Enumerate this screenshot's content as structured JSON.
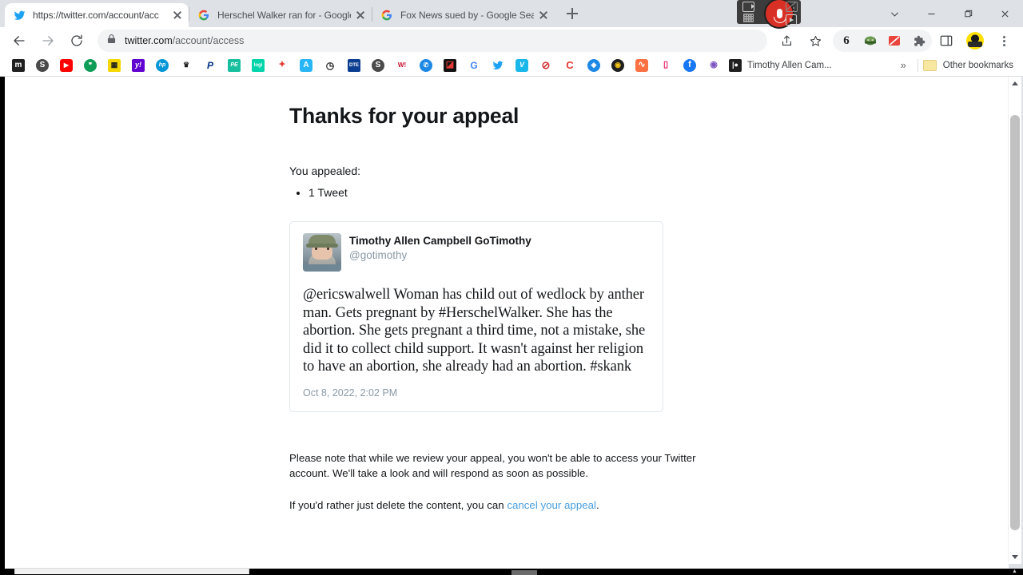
{
  "window": {
    "controls": [
      {
        "name": "tab-search",
        "glyph": "⌄"
      },
      {
        "name": "minimize",
        "glyph": "—"
      },
      {
        "name": "maximize",
        "glyph": "❐"
      },
      {
        "name": "close",
        "glyph": "✕"
      }
    ]
  },
  "tabs": [
    {
      "title": "https://twitter.com/account/acc",
      "favicon": "twitter-bird",
      "active": true
    },
    {
      "title": "Herschel Walker ran for - Google",
      "favicon": "google-g",
      "active": false
    },
    {
      "title": "Fox News sued by - Google Searc",
      "favicon": "google-g",
      "active": false
    }
  ],
  "newtab_label": "+",
  "recorder": {
    "mic_state": "recording",
    "icons": [
      "screen-capture-icon",
      "keypad-icon",
      "mic-record-button",
      "camera-off-icon",
      "play-icon"
    ]
  },
  "toolbar": {
    "back": "←",
    "forward": "→",
    "reload": "⟳",
    "url_domain": "twitter.com",
    "url_path": "/account/access",
    "share_icon": "share-icon",
    "bookmark_icon": "star-icon",
    "extensions": [
      {
        "name": "grammarly-extension",
        "label": "6",
        "bg": "#ffffff",
        "fg": "#1f1f1f"
      },
      {
        "name": "green-helmet-extension",
        "label": "",
        "bg": "#ffffff",
        "fg": "#2e7d32"
      },
      {
        "name": "red-block-extension",
        "label": "",
        "bg": "#ffffff",
        "fg": "#e53935"
      },
      {
        "name": "puzzle-extensions-icon",
        "label": "",
        "bg": "#ffffff",
        "fg": "#5f6368"
      }
    ],
    "side_panel_icon": "side-panel-icon",
    "profile_icon": "profile-avatar",
    "menu_icon": "three-dot-menu-icon"
  },
  "bookmarks": {
    "items": [
      {
        "name": "bookmark-m",
        "label": "m",
        "bg": "#1f1f1f",
        "fg": "#ffffff"
      },
      {
        "name": "bookmark-globe-1",
        "label": "S",
        "bg": "#4a4a4a",
        "fg": "#ffffff"
      },
      {
        "name": "bookmark-youtube",
        "label": "▶",
        "bg": "#ff0000",
        "fg": "#ffffff"
      },
      {
        "name": "bookmark-hangouts",
        "label": "❞",
        "bg": "#0f9d58",
        "fg": "#ffffff"
      },
      {
        "name": "bookmark-qr",
        "label": "▦",
        "bg": "#f5d800",
        "fg": "#1f1f1f"
      },
      {
        "name": "bookmark-yahoo",
        "label": "y!",
        "bg": "#6001d2",
        "fg": "#ffffff"
      },
      {
        "name": "bookmark-hp",
        "label": "hp",
        "bg": "#0096d6",
        "fg": "#ffffff"
      },
      {
        "name": "bookmark-crest",
        "label": "W",
        "bg": "#ffffff",
        "fg": "#1f1f1f"
      },
      {
        "name": "bookmark-paypal",
        "label": "P",
        "bg": "#ffffff",
        "fg": "#003087"
      },
      {
        "name": "bookmark-pe",
        "label": "PE",
        "bg": "#1abc9c",
        "fg": "#ffffff"
      },
      {
        "name": "bookmark-logi",
        "label": "logi",
        "bg": "#00d4aa",
        "fg": "#ffffff"
      },
      {
        "name": "bookmark-red-swirl",
        "label": "✦",
        "bg": "#ffffff",
        "fg": "#e03c31"
      },
      {
        "name": "bookmark-a",
        "label": "A",
        "bg": "#29b6f6",
        "fg": "#ffffff"
      },
      {
        "name": "bookmark-speedtest",
        "label": "◷",
        "bg": "#ffffff",
        "fg": "#1f1f1f"
      },
      {
        "name": "bookmark-dte",
        "label": "DTE",
        "bg": "#0b3d91",
        "fg": "#ffffff"
      },
      {
        "name": "bookmark-globe-2",
        "label": "S",
        "bg": "#4a4a4a",
        "fg": "#ffffff"
      },
      {
        "name": "bookmark-w",
        "label": "W!",
        "bg": "#ffffff",
        "fg": "#c8102e"
      },
      {
        "name": "bookmark-chat",
        "label": "✆",
        "bg": "#ffffff",
        "fg": "#1e88e5"
      },
      {
        "name": "bookmark-black-red",
        "label": "◪",
        "bg": "#111111",
        "fg": "#e53935"
      },
      {
        "name": "bookmark-google",
        "label": "G",
        "bg": "#ffffff",
        "fg": "#4285f4"
      },
      {
        "name": "bookmark-twitter",
        "label": "🐦",
        "bg": "#ffffff",
        "fg": "#1da1f2"
      },
      {
        "name": "bookmark-vimeo",
        "label": "V",
        "bg": "#1ab7ea",
        "fg": "#ffffff"
      },
      {
        "name": "bookmark-no-entry",
        "label": "⊘",
        "bg": "#ffffff",
        "fg": "#d32f2f"
      },
      {
        "name": "bookmark-c",
        "label": "C",
        "bg": "#ffffff",
        "fg": "#e53935"
      },
      {
        "name": "bookmark-blue-globe",
        "label": "◈",
        "bg": "#ffffff",
        "fg": "#1e88e5"
      },
      {
        "name": "bookmark-lock",
        "label": "◉",
        "bg": "#1f1f1f",
        "fg": "#f5c518"
      },
      {
        "name": "bookmark-orange-wave",
        "label": "∿",
        "bg": "#ff7043",
        "fg": "#ffffff"
      },
      {
        "name": "bookmark-bag",
        "label": "▯",
        "bg": "#ffffff",
        "fg": "#e91e63"
      },
      {
        "name": "bookmark-facebook",
        "label": "f",
        "bg": "#1877f2",
        "fg": "#ffffff"
      },
      {
        "name": "bookmark-purple",
        "label": "◉",
        "bg": "#ffffff",
        "fg": "#7e57c2"
      }
    ],
    "labeled_item": {
      "name": "bookmark-patreon-timothy",
      "label": "Timothy Allen Cam...",
      "icon": "patreon-icon"
    },
    "overflow_label": "»",
    "other_bookmarks_label": "Other bookmarks"
  },
  "page": {
    "title": "Thanks for your appeal",
    "appealed_label": "You appealed:",
    "appealed_items": [
      "1 Tweet"
    ],
    "tweet": {
      "display_name": "Timothy Allen Campbell GoTimothy",
      "handle": "@gotimothy",
      "text": "@ericswalwell Woman has child out of wedlock by anther man. Gets pregnant by #HerschelWalker. She has the abortion. She gets pregnant a third time, not a mistake, she did it to collect child support. It wasn't against her religion to have an abortion, she already had an abortion. #skank",
      "timestamp": "Oct 8, 2022, 2:02 PM",
      "avatar_alt": "bearded-man-avatar"
    },
    "note_line1": "Please note that while we review your appeal, you won't be able to access your Twitter account. We'll take a look and will respond as soon as possible.",
    "note_line2_prefix": "If you'd rather just delete the content, you can ",
    "cancel_link_label": "cancel your appeal",
    "note_line2_suffix": "."
  },
  "colors": {
    "twitter_blue": "#1da1f2",
    "link_blue": "#4a9fe0",
    "muted_gray": "#8899a6",
    "chrome_bg": "#dee1e6",
    "record_red": "#d93025"
  }
}
